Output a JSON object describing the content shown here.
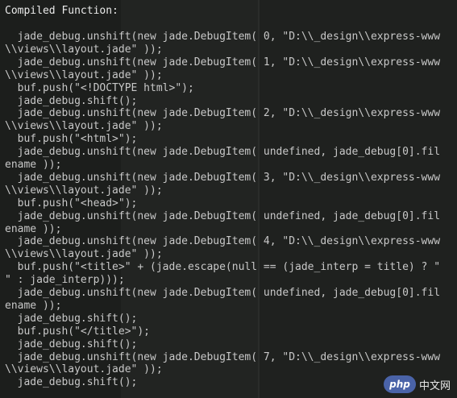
{
  "console": {
    "header": "Compiled Function:",
    "lines": [
      "jade_debug.unshift(new jade.DebugItem( 0, \"D:\\\\_design\\\\express-www",
      "\\\\views\\\\layout.jade\" ));",
      "jade_debug.unshift(new jade.DebugItem( 1, \"D:\\\\_design\\\\express-www",
      "\\\\views\\\\layout.jade\" ));",
      "buf.push(\"<!DOCTYPE html>\");",
      "jade_debug.shift();",
      "jade_debug.unshift(new jade.DebugItem( 2, \"D:\\\\_design\\\\express-www",
      "\\\\views\\\\layout.jade\" ));",
      "buf.push(\"<html>\");",
      "jade_debug.unshift(new jade.DebugItem( undefined, jade_debug[0].fil",
      "ename ));",
      "jade_debug.unshift(new jade.DebugItem( 3, \"D:\\\\_design\\\\express-www",
      "\\\\views\\\\layout.jade\" ));",
      "buf.push(\"<head>\");",
      "jade_debug.unshift(new jade.DebugItem( undefined, jade_debug[0].fil",
      "ename ));",
      "jade_debug.unshift(new jade.DebugItem( 4, \"D:\\\\_design\\\\express-www",
      "\\\\views\\\\layout.jade\" ));",
      "buf.push(\"<title>\" + (jade.escape(null == (jade_interp = title) ? \"",
      "\" : jade_interp)));",
      "jade_debug.unshift(new jade.DebugItem( undefined, jade_debug[0].fil",
      "ename ));",
      "jade_debug.shift();",
      "buf.push(\"</title>\");",
      "jade_debug.shift();",
      "jade_debug.unshift(new jade.DebugItem( 7, \"D:\\\\_design\\\\express-www",
      "\\\\views\\\\layout.jade\" ));",
      "jade_debug.shift();"
    ],
    "indents": [
      2,
      0,
      2,
      0,
      2,
      2,
      2,
      0,
      2,
      2,
      0,
      2,
      0,
      2,
      2,
      0,
      2,
      0,
      2,
      0,
      2,
      0,
      2,
      2,
      2,
      2,
      0,
      2
    ]
  },
  "watermark": {
    "logo_text": "php",
    "site_text": "中文网"
  },
  "colors": {
    "background": "#1c1e1c",
    "text": "#c8c8c8",
    "watermark_logo": "#4a63a8"
  }
}
